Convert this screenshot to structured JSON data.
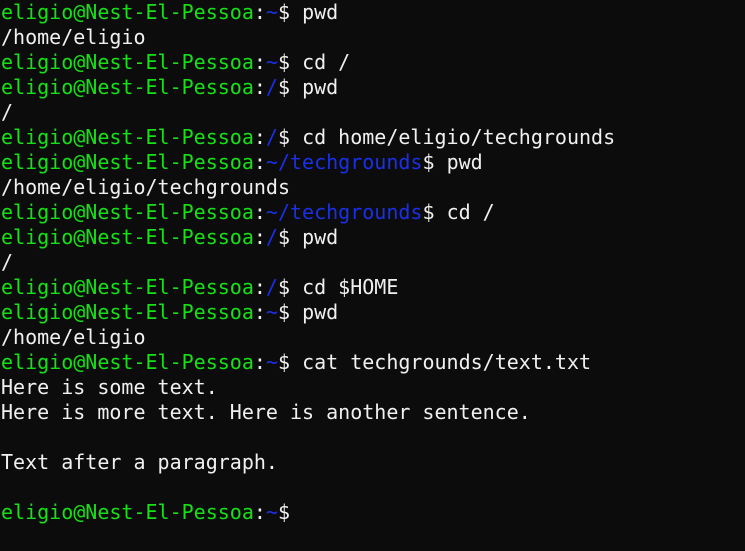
{
  "terminal": {
    "colors": {
      "prompt_user": "#16e016",
      "prompt_path": "#1a30e8",
      "text": "#f0f0f0",
      "background": "#0c0c0c"
    },
    "lines": [
      {
        "type": "prompt",
        "user": "eligio@Nest-El-Pessoa",
        "sep": ":",
        "path": "~",
        "dollar": "$ ",
        "cmd": "pwd"
      },
      {
        "type": "output",
        "text": "/home/eligio"
      },
      {
        "type": "prompt",
        "user": "eligio@Nest-El-Pessoa",
        "sep": ":",
        "path": "~",
        "dollar": "$ ",
        "cmd": "cd /"
      },
      {
        "type": "prompt",
        "user": "eligio@Nest-El-Pessoa",
        "sep": ":",
        "path": "/",
        "dollar": "$ ",
        "cmd": "pwd"
      },
      {
        "type": "output",
        "text": "/"
      },
      {
        "type": "prompt",
        "user": "eligio@Nest-El-Pessoa",
        "sep": ":",
        "path": "/",
        "dollar": "$ ",
        "cmd": "cd home/eligio/techgrounds"
      },
      {
        "type": "prompt",
        "user": "eligio@Nest-El-Pessoa",
        "sep": ":",
        "path": "~/techgrounds",
        "dollar": "$ ",
        "cmd": "pwd"
      },
      {
        "type": "output",
        "text": "/home/eligio/techgrounds"
      },
      {
        "type": "prompt",
        "user": "eligio@Nest-El-Pessoa",
        "sep": ":",
        "path": "~/techgrounds",
        "dollar": "$ ",
        "cmd": "cd /"
      },
      {
        "type": "prompt",
        "user": "eligio@Nest-El-Pessoa",
        "sep": ":",
        "path": "/",
        "dollar": "$ ",
        "cmd": "pwd"
      },
      {
        "type": "output",
        "text": "/"
      },
      {
        "type": "prompt",
        "user": "eligio@Nest-El-Pessoa",
        "sep": ":",
        "path": "/",
        "dollar": "$ ",
        "cmd": "cd $HOME"
      },
      {
        "type": "prompt",
        "user": "eligio@Nest-El-Pessoa",
        "sep": ":",
        "path": "~",
        "dollar": "$ ",
        "cmd": "pwd"
      },
      {
        "type": "output",
        "text": "/home/eligio"
      },
      {
        "type": "prompt",
        "user": "eligio@Nest-El-Pessoa",
        "sep": ":",
        "path": "~",
        "dollar": "$ ",
        "cmd": "cat techgrounds/text.txt"
      },
      {
        "type": "output",
        "text": "Here is some text."
      },
      {
        "type": "output",
        "text": "Here is more text. Here is another sentence."
      },
      {
        "type": "output",
        "text": ""
      },
      {
        "type": "output",
        "text": "Text after a paragraph."
      },
      {
        "type": "output",
        "text": ""
      },
      {
        "type": "prompt",
        "user": "eligio@Nest-El-Pessoa",
        "sep": ":",
        "path": "~",
        "dollar": "$",
        "cmd": ""
      }
    ]
  }
}
